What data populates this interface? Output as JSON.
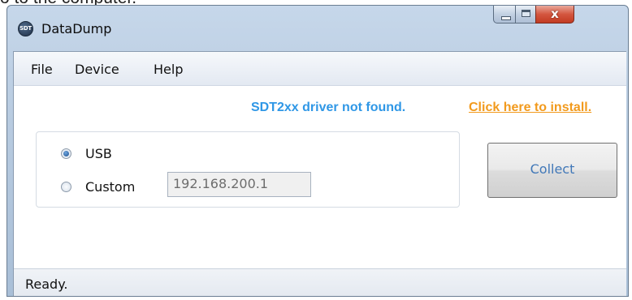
{
  "doc_fragment": "o to the computer.",
  "window": {
    "title": "DataDump",
    "icon_text": "SDT",
    "controls": {
      "minimize_icon": "minimize-icon",
      "maximize_icon": "maximize-icon",
      "close_icon": "close-icon",
      "close_glyph": "x"
    }
  },
  "menu": {
    "file": "File",
    "device": "Device",
    "help": "Help"
  },
  "driver_notice": {
    "message": "SDT2xx driver not found.",
    "link": "Click here to install."
  },
  "connection": {
    "usb_label": "USB",
    "custom_label": "Custom",
    "selected": "USB",
    "custom_ip": "192.168.200.1"
  },
  "collect_button": "Collect",
  "status": "Ready.",
  "colors": {
    "notice": "#2f97e6",
    "link": "#f29a1d",
    "button_text": "#4178b8",
    "close_button": "#c23b22"
  }
}
